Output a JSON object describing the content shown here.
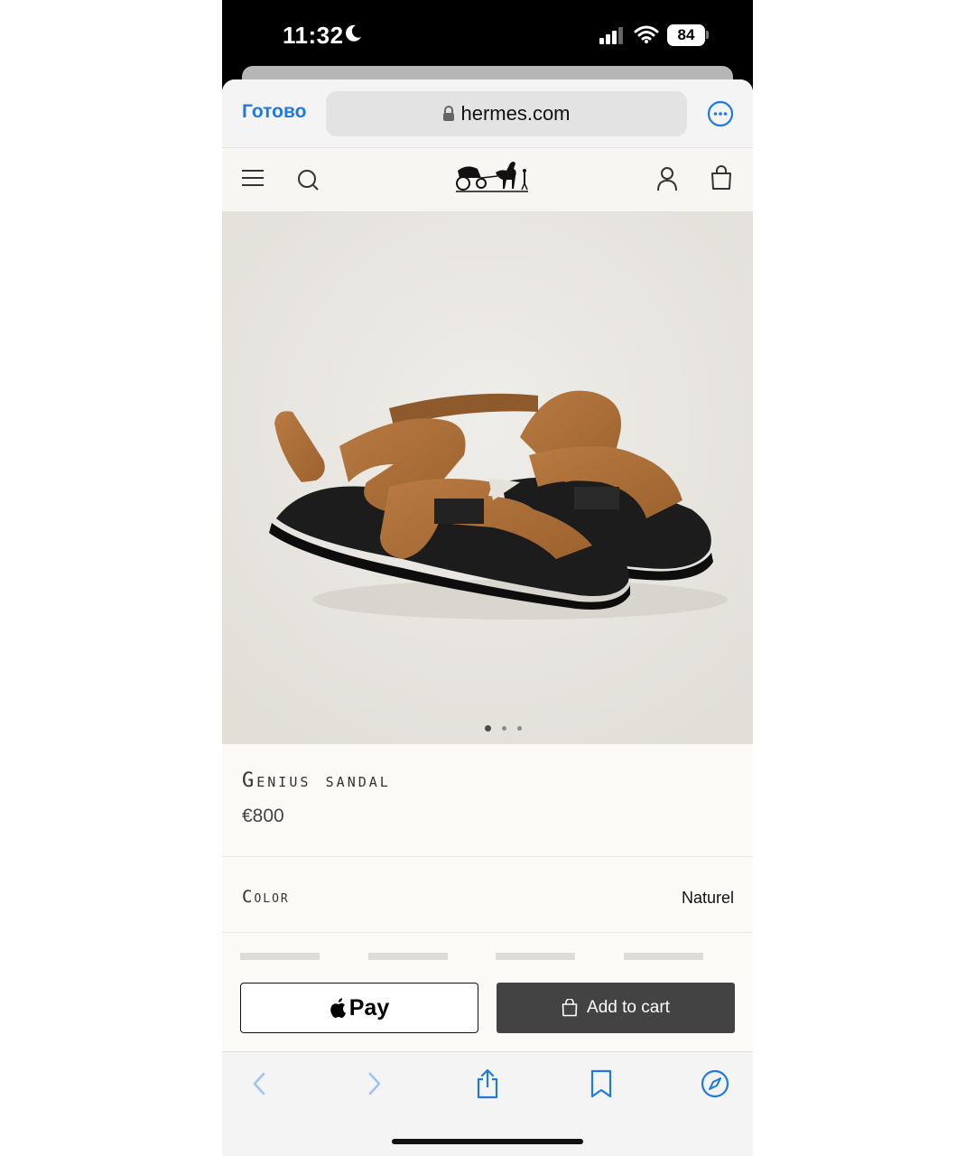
{
  "status_bar": {
    "time": "11:32",
    "battery": "84",
    "icons": [
      "moon-icon",
      "cellular-signal-icon",
      "wifi-icon",
      "battery-icon"
    ]
  },
  "browser": {
    "done_label": "Готово",
    "url": "hermes.com",
    "accent_color": "#1f7ae0",
    "icons": [
      "lock-icon",
      "more-options-icon"
    ]
  },
  "site_header": {
    "icons": [
      "menu-icon",
      "search-icon",
      "hermes-logo",
      "account-icon",
      "shopping-bag-icon"
    ]
  },
  "gallery": {
    "image": "brown leather sandals with black soles",
    "total_images": 3,
    "active_index": 1
  },
  "product": {
    "name": "Genius sandal",
    "price": "€800"
  },
  "color": {
    "label": "Color",
    "value": "Naturel"
  },
  "actions": {
    "apple_pay_label": "Pay",
    "add_to_cart_label": "Add to cart"
  },
  "toolbar": {
    "icons": [
      "back-icon",
      "forward-icon",
      "share-icon",
      "bookmarks-icon",
      "compass-icon"
    ]
  }
}
